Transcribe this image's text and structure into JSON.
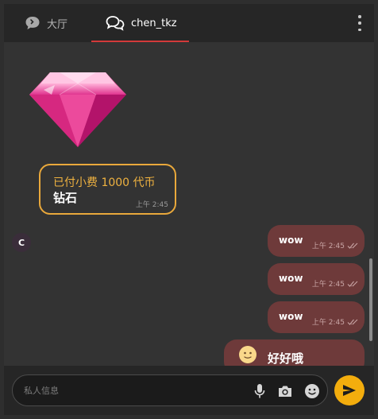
{
  "header": {
    "tabs": [
      {
        "label": "大厅",
        "icon": "chat-bubble-icon",
        "active": false
      },
      {
        "label": "chen_tkz",
        "icon": "two-chat-bubbles-icon",
        "active": true
      }
    ],
    "menu_icon": "kebab-menu-icon"
  },
  "chat": {
    "received": [
      {
        "avatar_initial": "C",
        "sticker": "pink-diamond-gem",
        "tip_text": "已付小费 1000 代币",
        "gift_name": "钻石",
        "time": "上午 2:45"
      }
    ],
    "sent": [
      {
        "text": "wow",
        "time": "上午 2:45",
        "status": "read-double-check"
      },
      {
        "text": "wow",
        "time": "上午 2:45",
        "status": "read-double-check"
      },
      {
        "text": "wow",
        "time": "上午 2:45",
        "status": "read-double-check"
      },
      {
        "emoji": "slightly-smiling-face",
        "text": "好好哦"
      }
    ]
  },
  "composer": {
    "placeholder": "私人信息",
    "icons": [
      "microphone-icon",
      "camera-icon",
      "emoji-icon"
    ],
    "send_icon": "send-arrow-icon"
  },
  "colors": {
    "accent_send": "#f3ad0d",
    "tip_border": "#e9a83b",
    "sent_bubble": "#6e3a3a",
    "tab_underline": "#d23a3a"
  }
}
